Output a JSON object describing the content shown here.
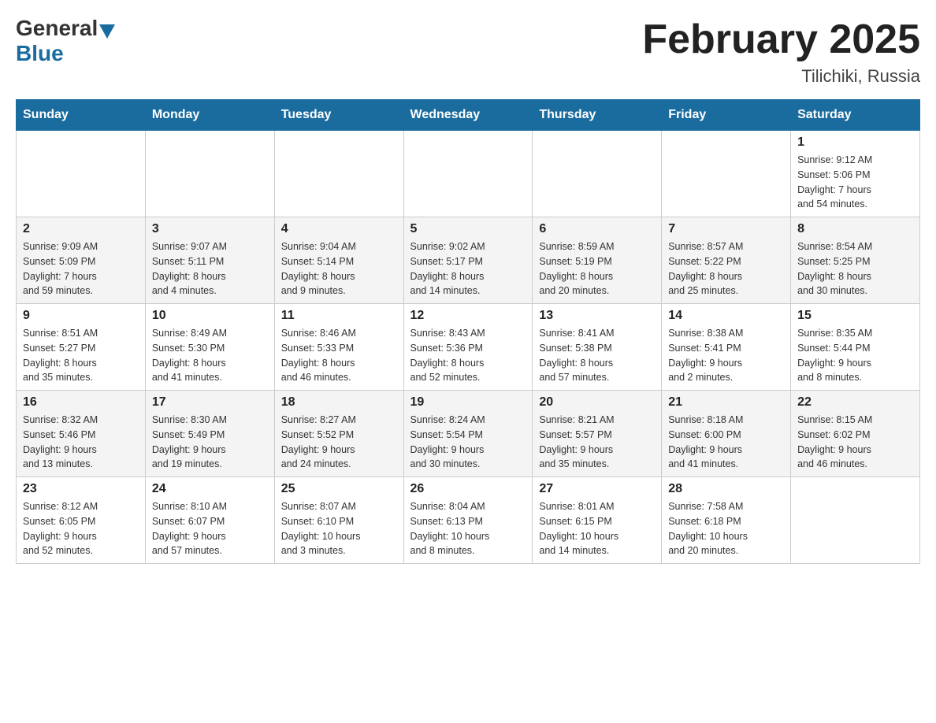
{
  "header": {
    "logo_general": "General",
    "logo_blue": "Blue",
    "title": "February 2025",
    "subtitle": "Tilichiki, Russia"
  },
  "days_of_week": [
    "Sunday",
    "Monday",
    "Tuesday",
    "Wednesday",
    "Thursday",
    "Friday",
    "Saturday"
  ],
  "weeks": [
    [
      {
        "day": "",
        "info": ""
      },
      {
        "day": "",
        "info": ""
      },
      {
        "day": "",
        "info": ""
      },
      {
        "day": "",
        "info": ""
      },
      {
        "day": "",
        "info": ""
      },
      {
        "day": "",
        "info": ""
      },
      {
        "day": "1",
        "info": "Sunrise: 9:12 AM\nSunset: 5:06 PM\nDaylight: 7 hours\nand 54 minutes."
      }
    ],
    [
      {
        "day": "2",
        "info": "Sunrise: 9:09 AM\nSunset: 5:09 PM\nDaylight: 7 hours\nand 59 minutes."
      },
      {
        "day": "3",
        "info": "Sunrise: 9:07 AM\nSunset: 5:11 PM\nDaylight: 8 hours\nand 4 minutes."
      },
      {
        "day": "4",
        "info": "Sunrise: 9:04 AM\nSunset: 5:14 PM\nDaylight: 8 hours\nand 9 minutes."
      },
      {
        "day": "5",
        "info": "Sunrise: 9:02 AM\nSunset: 5:17 PM\nDaylight: 8 hours\nand 14 minutes."
      },
      {
        "day": "6",
        "info": "Sunrise: 8:59 AM\nSunset: 5:19 PM\nDaylight: 8 hours\nand 20 minutes."
      },
      {
        "day": "7",
        "info": "Sunrise: 8:57 AM\nSunset: 5:22 PM\nDaylight: 8 hours\nand 25 minutes."
      },
      {
        "day": "8",
        "info": "Sunrise: 8:54 AM\nSunset: 5:25 PM\nDaylight: 8 hours\nand 30 minutes."
      }
    ],
    [
      {
        "day": "9",
        "info": "Sunrise: 8:51 AM\nSunset: 5:27 PM\nDaylight: 8 hours\nand 35 minutes."
      },
      {
        "day": "10",
        "info": "Sunrise: 8:49 AM\nSunset: 5:30 PM\nDaylight: 8 hours\nand 41 minutes."
      },
      {
        "day": "11",
        "info": "Sunrise: 8:46 AM\nSunset: 5:33 PM\nDaylight: 8 hours\nand 46 minutes."
      },
      {
        "day": "12",
        "info": "Sunrise: 8:43 AM\nSunset: 5:36 PM\nDaylight: 8 hours\nand 52 minutes."
      },
      {
        "day": "13",
        "info": "Sunrise: 8:41 AM\nSunset: 5:38 PM\nDaylight: 8 hours\nand 57 minutes."
      },
      {
        "day": "14",
        "info": "Sunrise: 8:38 AM\nSunset: 5:41 PM\nDaylight: 9 hours\nand 2 minutes."
      },
      {
        "day": "15",
        "info": "Sunrise: 8:35 AM\nSunset: 5:44 PM\nDaylight: 9 hours\nand 8 minutes."
      }
    ],
    [
      {
        "day": "16",
        "info": "Sunrise: 8:32 AM\nSunset: 5:46 PM\nDaylight: 9 hours\nand 13 minutes."
      },
      {
        "day": "17",
        "info": "Sunrise: 8:30 AM\nSunset: 5:49 PM\nDaylight: 9 hours\nand 19 minutes."
      },
      {
        "day": "18",
        "info": "Sunrise: 8:27 AM\nSunset: 5:52 PM\nDaylight: 9 hours\nand 24 minutes."
      },
      {
        "day": "19",
        "info": "Sunrise: 8:24 AM\nSunset: 5:54 PM\nDaylight: 9 hours\nand 30 minutes."
      },
      {
        "day": "20",
        "info": "Sunrise: 8:21 AM\nSunset: 5:57 PM\nDaylight: 9 hours\nand 35 minutes."
      },
      {
        "day": "21",
        "info": "Sunrise: 8:18 AM\nSunset: 6:00 PM\nDaylight: 9 hours\nand 41 minutes."
      },
      {
        "day": "22",
        "info": "Sunrise: 8:15 AM\nSunset: 6:02 PM\nDaylight: 9 hours\nand 46 minutes."
      }
    ],
    [
      {
        "day": "23",
        "info": "Sunrise: 8:12 AM\nSunset: 6:05 PM\nDaylight: 9 hours\nand 52 minutes."
      },
      {
        "day": "24",
        "info": "Sunrise: 8:10 AM\nSunset: 6:07 PM\nDaylight: 9 hours\nand 57 minutes."
      },
      {
        "day": "25",
        "info": "Sunrise: 8:07 AM\nSunset: 6:10 PM\nDaylight: 10 hours\nand 3 minutes."
      },
      {
        "day": "26",
        "info": "Sunrise: 8:04 AM\nSunset: 6:13 PM\nDaylight: 10 hours\nand 8 minutes."
      },
      {
        "day": "27",
        "info": "Sunrise: 8:01 AM\nSunset: 6:15 PM\nDaylight: 10 hours\nand 14 minutes."
      },
      {
        "day": "28",
        "info": "Sunrise: 7:58 AM\nSunset: 6:18 PM\nDaylight: 10 hours\nand 20 minutes."
      },
      {
        "day": "",
        "info": ""
      }
    ]
  ]
}
